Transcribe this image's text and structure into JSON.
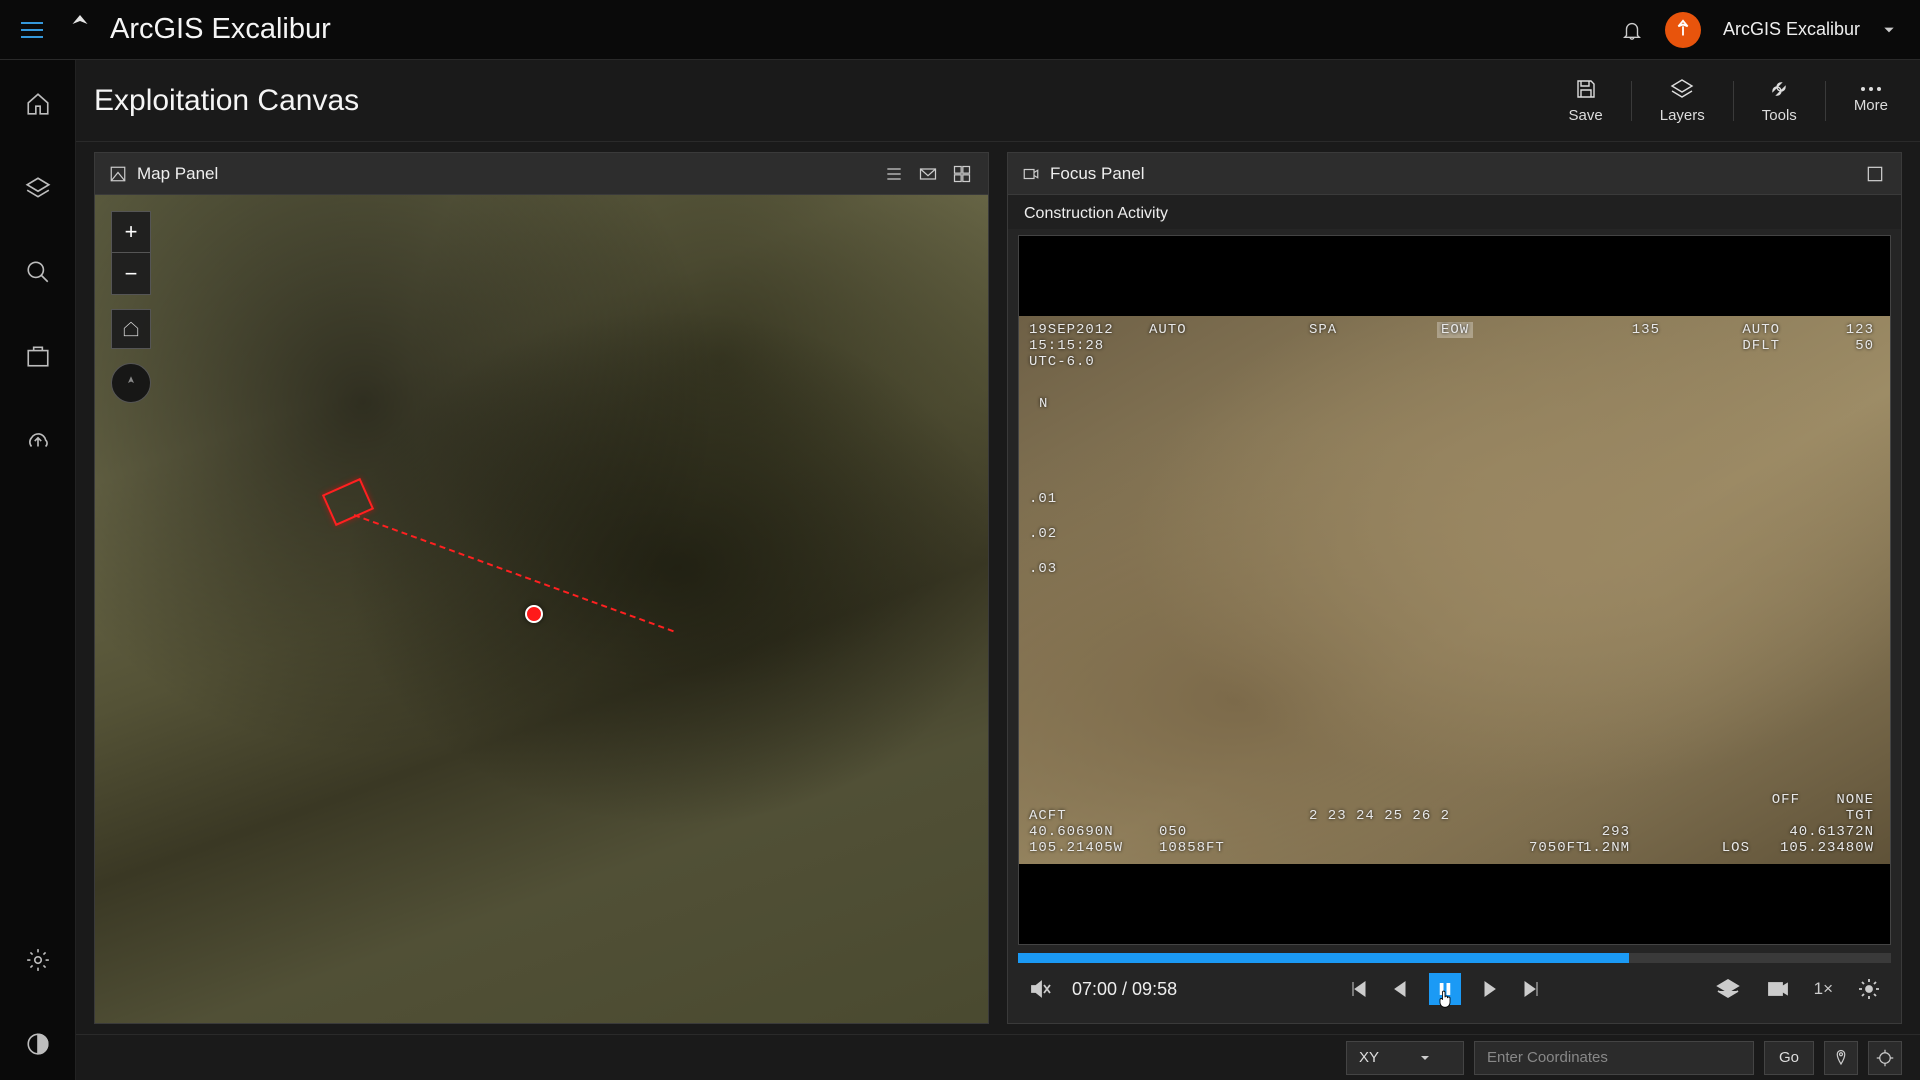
{
  "app": {
    "title": "ArcGIS Excalibur",
    "user_label": "ArcGIS Excalibur"
  },
  "page": {
    "title": "Exploitation Canvas"
  },
  "toolbar": {
    "save": "Save",
    "layers": "Layers",
    "tools": "Tools",
    "more": "More"
  },
  "map_panel": {
    "title": "Map Panel"
  },
  "focus_panel": {
    "title": "Focus Panel",
    "subtitle": "Construction Activity"
  },
  "video": {
    "current_time": "07:00",
    "duration": "09:58",
    "time_display": "07:00 / 09:58",
    "speed": "1×",
    "progress_pct": 70
  },
  "hud": {
    "date": "19SEP2012",
    "time": "15:15:28",
    "utc": "UTC-6.0",
    "auto_l": "AUTO",
    "spa": "SPA",
    "eow": "EOW",
    "hdg": "135",
    "auto_r": "AUTO",
    "dflt": "DFLT",
    "fifty": "50",
    "r123": "123",
    "north": "N",
    "scale_01": ".01",
    "scale_02": ".02",
    "scale_03": ".03",
    "acft": "ACFT",
    "lat_l": "40.60690N",
    "lon_l": "105.21405W",
    "fifty2": "050",
    "alt1": "10858FT",
    "ticks": "2  23  24  25  26  2",
    "alt2": "7050FT",
    "r293": "293",
    "r12nm": "1.2NM",
    "off": "OFF",
    "none": "NONE",
    "tgt": "TGT",
    "lat_r": "40.61372N",
    "los": "LOS",
    "lon_r": "105.23480W"
  },
  "footer": {
    "coord_type": "XY",
    "placeholder": "Enter Coordinates",
    "go": "Go"
  }
}
